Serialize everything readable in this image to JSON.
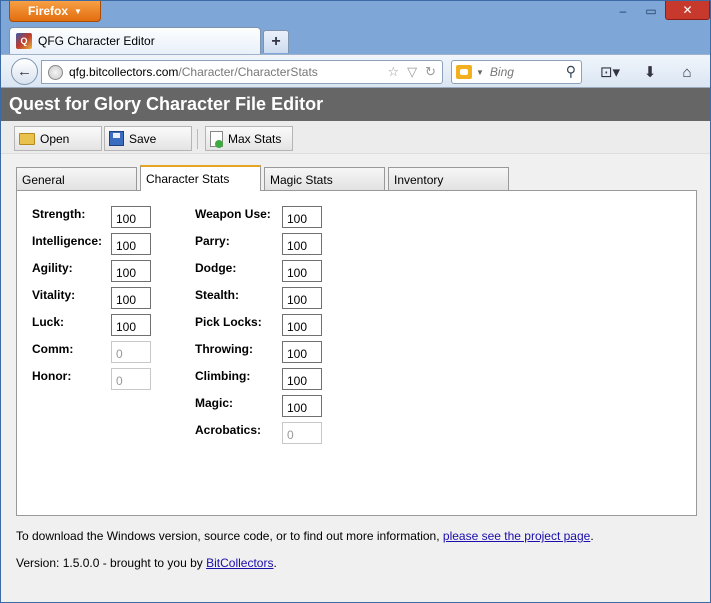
{
  "browser": {
    "menu_button": "Firefox",
    "tab_title": "QFG Character Editor",
    "url_domain": "qfg.bitcollectors.com",
    "url_path": "/Character/CharacterStats",
    "search_placeholder": "Bing",
    "window_controls": {
      "minimize": "–",
      "maximize": "▭",
      "close": "✕"
    },
    "icons": {
      "new_tab": "+",
      "back": "←",
      "star": "☆",
      "dropdown": "▽",
      "reload": "↻",
      "search": "⚲",
      "bookmarks": "⊡▾",
      "download": "⬇",
      "home": "⌂"
    }
  },
  "app": {
    "title": "Quest for Glory Character File Editor",
    "toolbar": {
      "open": "Open",
      "save": "Save",
      "max_stats": "Max Stats"
    },
    "tabs": [
      {
        "label": "General"
      },
      {
        "label": "Character Stats"
      },
      {
        "label": "Magic Stats"
      },
      {
        "label": "Inventory"
      }
    ],
    "stats_left": [
      {
        "label": "Strength:",
        "value": "100"
      },
      {
        "label": "Intelligence:",
        "value": "100"
      },
      {
        "label": "Agility:",
        "value": "100"
      },
      {
        "label": "Vitality:",
        "value": "100"
      },
      {
        "label": "Luck:",
        "value": "100"
      },
      {
        "label": "Comm:",
        "value": "0"
      },
      {
        "label": "Honor:",
        "value": "0"
      }
    ],
    "stats_right": [
      {
        "label": "Weapon Use:",
        "value": "100"
      },
      {
        "label": "Parry:",
        "value": "100"
      },
      {
        "label": "Dodge:",
        "value": "100"
      },
      {
        "label": "Stealth:",
        "value": "100"
      },
      {
        "label": "Pick Locks:",
        "value": "100"
      },
      {
        "label": "Throwing:",
        "value": "100"
      },
      {
        "label": "Climbing:",
        "value": "100"
      },
      {
        "label": "Magic:",
        "value": "100"
      },
      {
        "label": "Acrobatics:",
        "value": "0"
      }
    ],
    "footer": {
      "download_text": "To download the Windows version, source code, or to find out more information, ",
      "project_link": "please see the project page",
      "download_end": ".",
      "version_text": "Version: 1.5.0.0 - brought to you by ",
      "bitcollectors_link": "BitCollectors",
      "version_end": "."
    }
  }
}
